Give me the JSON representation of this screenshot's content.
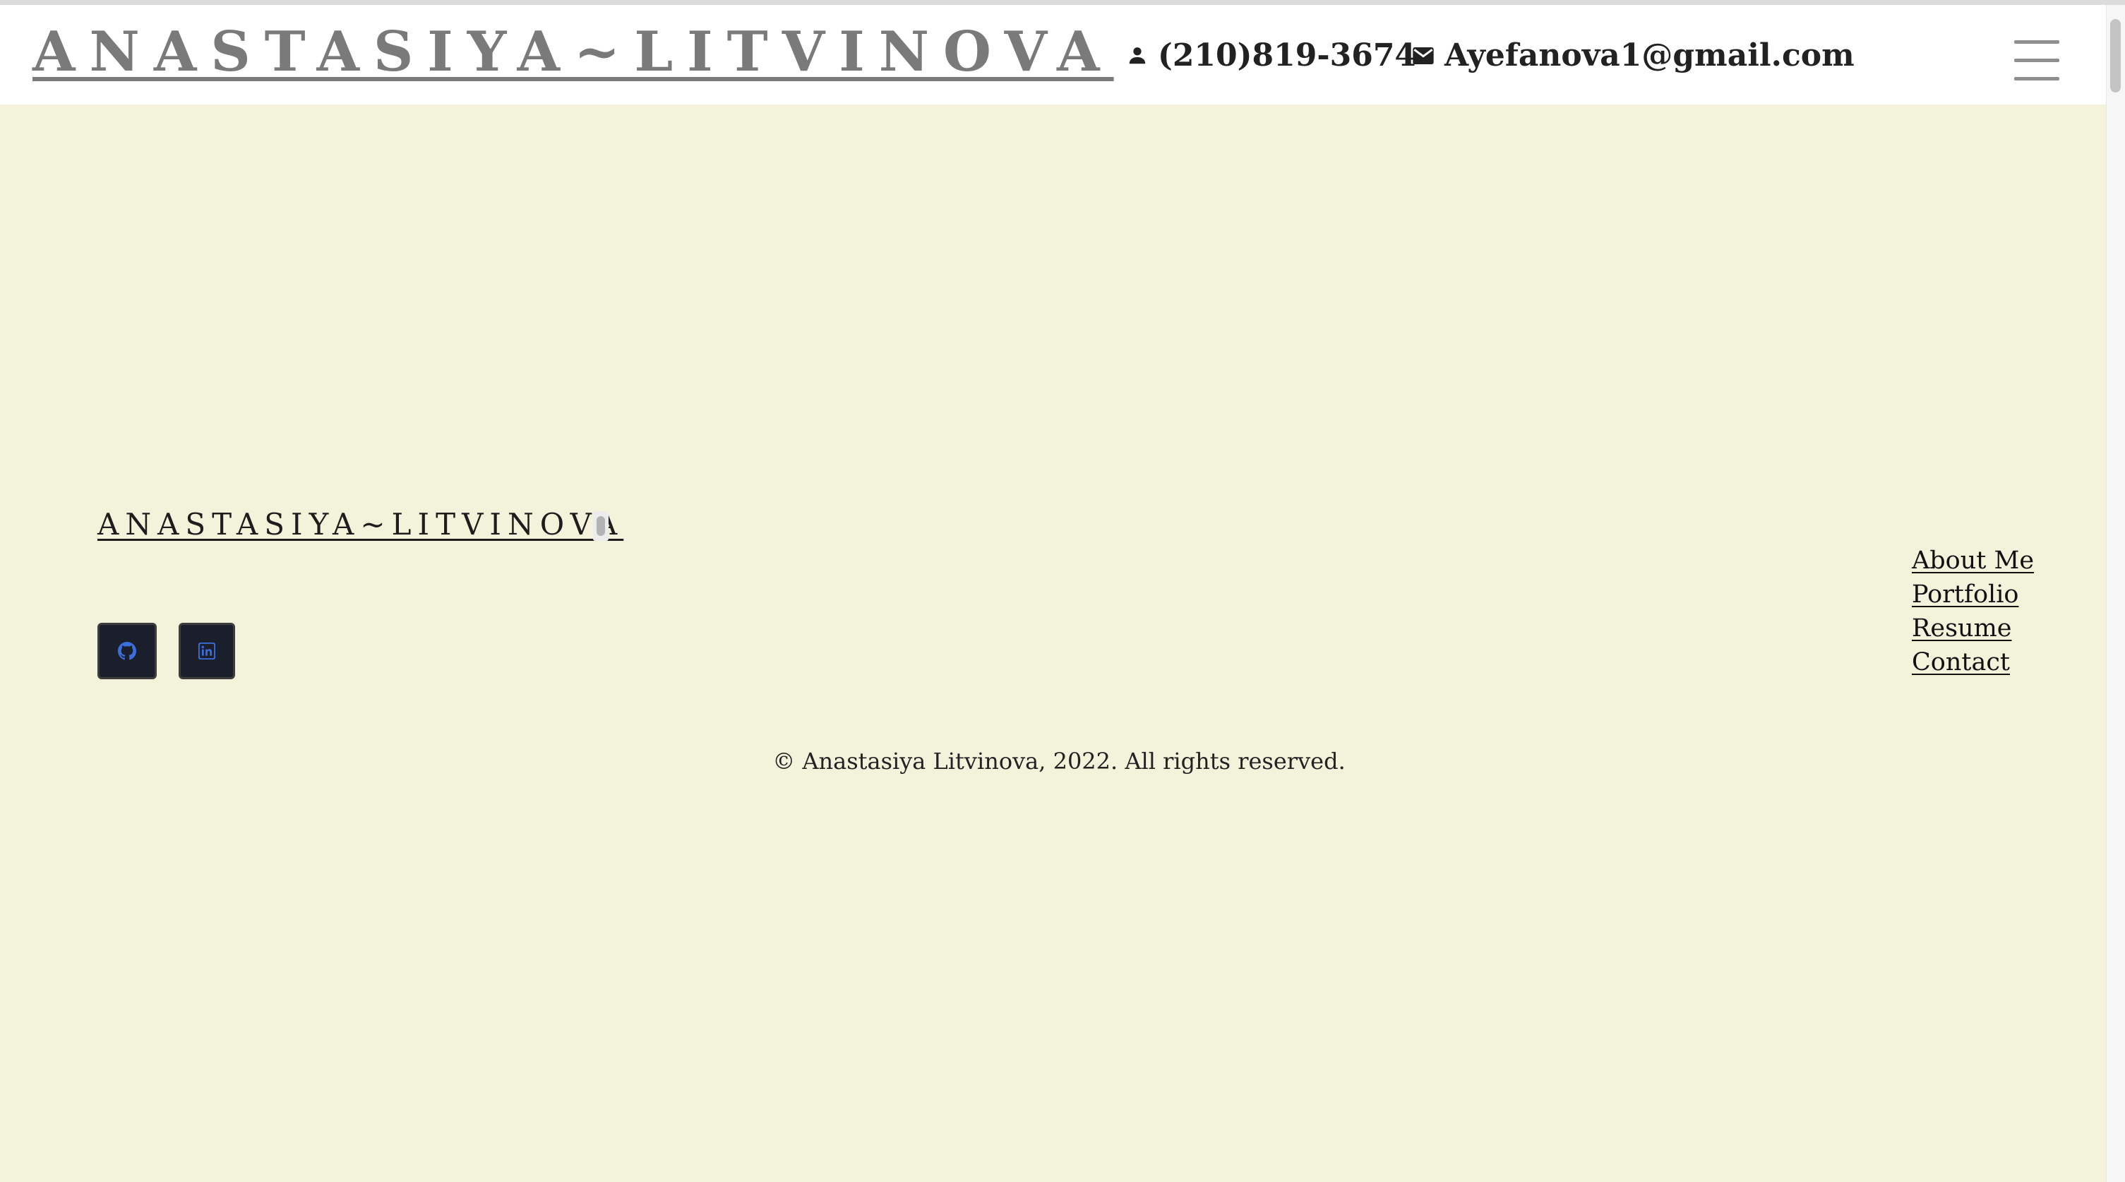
{
  "header": {
    "site_title": "ANASTASIYA~LITVINOVA",
    "phone": "(210)819-3674",
    "email": "Ayefanova1@gmail.com"
  },
  "footer": {
    "title": "ANASTASIYA~LITVINOVA",
    "social": [
      "github-icon",
      "linkedin-icon"
    ],
    "nav": [
      "About Me",
      "Portfolio",
      "Resume",
      "Contact"
    ],
    "copyright": "© Anastasiya Litvinova, 2022. All rights reserved."
  },
  "colors": {
    "page_background": "#f3f3dc",
    "header_background": "#ffffff",
    "title_gray": "#7a7a7a",
    "social_button": "#1b1f2b",
    "social_icon": "#3b6fe0"
  },
  "icons": {
    "phone_icon": "person-icon",
    "email_icon": "envelope-icon",
    "menu_icon": "hamburger-icon"
  }
}
